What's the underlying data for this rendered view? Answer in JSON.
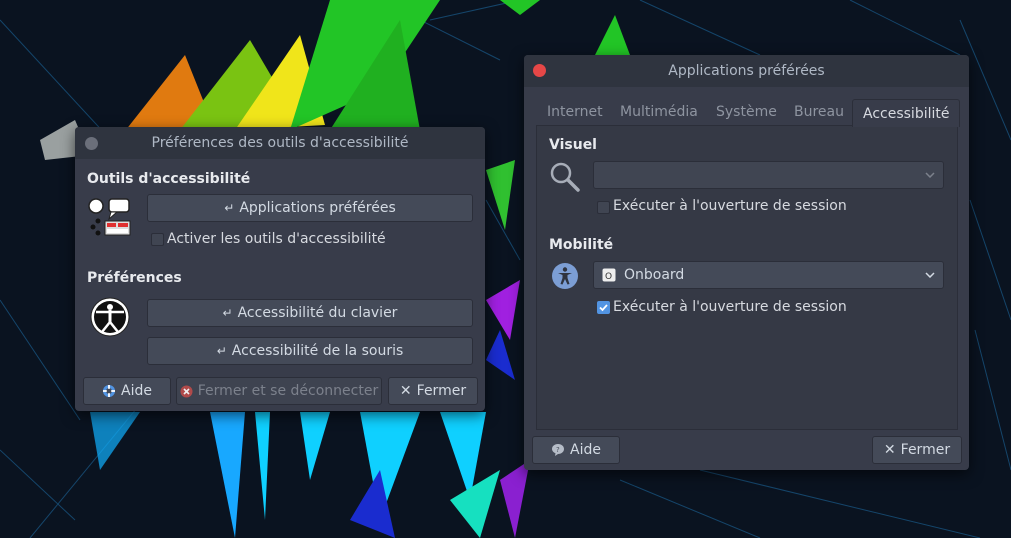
{
  "accessibility_prefs": {
    "title": "Préférences des outils d'accessibilité",
    "section_tools": "Outils d'accessibilité",
    "btn_preferred_apps": "Applications préférées",
    "chk_enable_tools": "Activer les outils d'accessibilité",
    "section_prefs": "Préférences",
    "btn_keyboard": "Accessibilité du clavier",
    "btn_mouse": "Accessibilité de la souris",
    "btn_help": "Aide",
    "btn_close_logout": "Fermer et se déconnecter",
    "btn_close": "Fermer"
  },
  "preferred_apps": {
    "title": "Applications préférées",
    "tabs": [
      "Internet",
      "Multimédia",
      "Système",
      "Bureau",
      "Accessibilité"
    ],
    "active_tab": "Accessibilité",
    "visual_label": "Visuel",
    "visual_selected": "",
    "visual_run_at_login": "Exécuter à l'ouverture de session",
    "visual_run_checked": false,
    "mobility_label": "Mobilité",
    "mobility_selected": "Onboard",
    "mobility_run_at_login": "Exécuter à l'ouverture de session",
    "mobility_run_checked": true,
    "btn_help": "Aide",
    "btn_close": "Fermer"
  },
  "colors": {
    "window_bg": "#383c4a",
    "titlebar_bg": "#2f343f",
    "accent": "#5294e2",
    "close_red": "#e64747"
  }
}
